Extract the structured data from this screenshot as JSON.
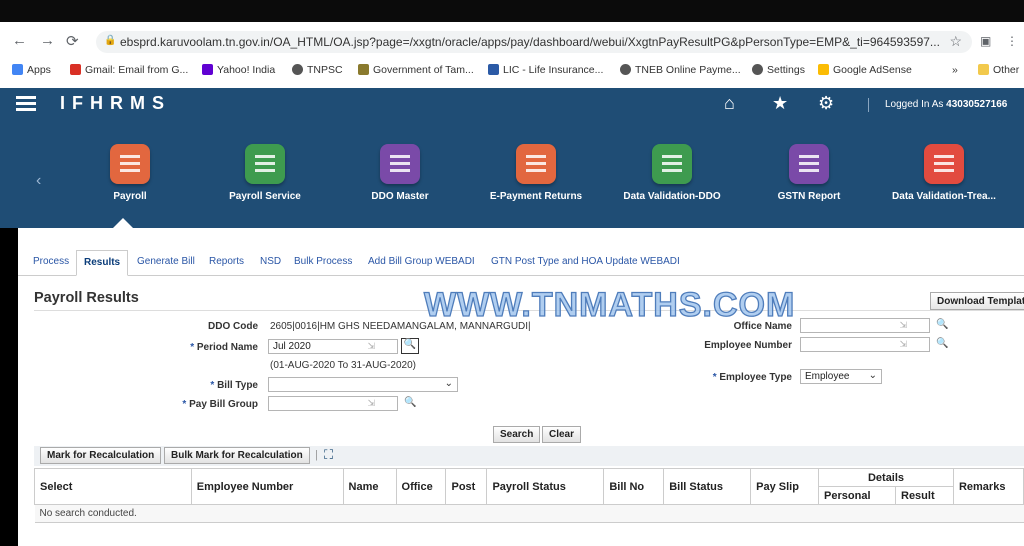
{
  "browser": {
    "url": "ebsprd.karuvoolam.tn.gov.in/OA_HTML/OA.jsp?page=/xxgtn/oracle/apps/pay/dashboard/webui/XxgtnPayResultPG&pPersonType=EMP&_ti=964593597...",
    "bookmarks": [
      "Apps",
      "Gmail: Email from G...",
      "Yahoo! India",
      "TNPSC",
      "Government of Tam...",
      "LIC - Life Insurance...",
      "TNEB Online Payme...",
      "Settings",
      "Google AdSense",
      "»",
      "Other"
    ]
  },
  "header": {
    "app_name": "IFHRMS",
    "logged_in_label": "Logged In As",
    "user_id": "43030527166"
  },
  "tiles": [
    {
      "label": "Payroll",
      "color": "#e2673f"
    },
    {
      "label": "Payroll Service",
      "color": "#3e9b4f"
    },
    {
      "label": "DDO Master",
      "color": "#7a4aa8"
    },
    {
      "label": "E-Payment Returns",
      "color": "#e2673f"
    },
    {
      "label": "Data Validation-DDO",
      "color": "#3e9b4f"
    },
    {
      "label": "GSTN Report",
      "color": "#7a4aa8"
    },
    {
      "label": "Data Validation-Trea...",
      "color": "#e24b3f"
    }
  ],
  "tabs": [
    "Process",
    "Results",
    "Generate Bill",
    "Reports",
    "NSD",
    "Bulk Process",
    "Add Bill Group WEBADI",
    "GTN Post Type and HOA Update WEBADI"
  ],
  "page": {
    "title": "Payroll Results",
    "download_button": "Download Templat",
    "watermark": "WWW.TNMATHS.COM"
  },
  "form": {
    "ddo_code_label": "DDO Code",
    "ddo_code_value": "2605|0016|HM GHS NEEDAMANGALAM, MANNARGUDI|",
    "period_label": "Period Name",
    "period_value": "Jul 2020",
    "period_range": "(01-AUG-2020 To 31-AUG-2020)",
    "bill_type_label": "Bill Type",
    "pay_bill_group_label": "Pay Bill Group",
    "office_name_label": "Office Name",
    "employee_number_label": "Employee Number",
    "employee_type_label": "Employee Type",
    "employee_type_value": "Employee",
    "search_button": "Search",
    "clear_button": "Clear"
  },
  "toolbar": {
    "mark_button": "Mark for Recalculation",
    "bulk_mark_button": "Bulk Mark for Recalculation"
  },
  "table": {
    "columns": [
      "Select",
      "Employee Number",
      "Name",
      "Office",
      "Post",
      "Payroll Status",
      "Bill No",
      "Bill Status",
      "Pay Slip",
      "Details",
      "Remarks"
    ],
    "details_sub": [
      "Personal",
      "Result"
    ],
    "empty_message": "No search conducted."
  }
}
